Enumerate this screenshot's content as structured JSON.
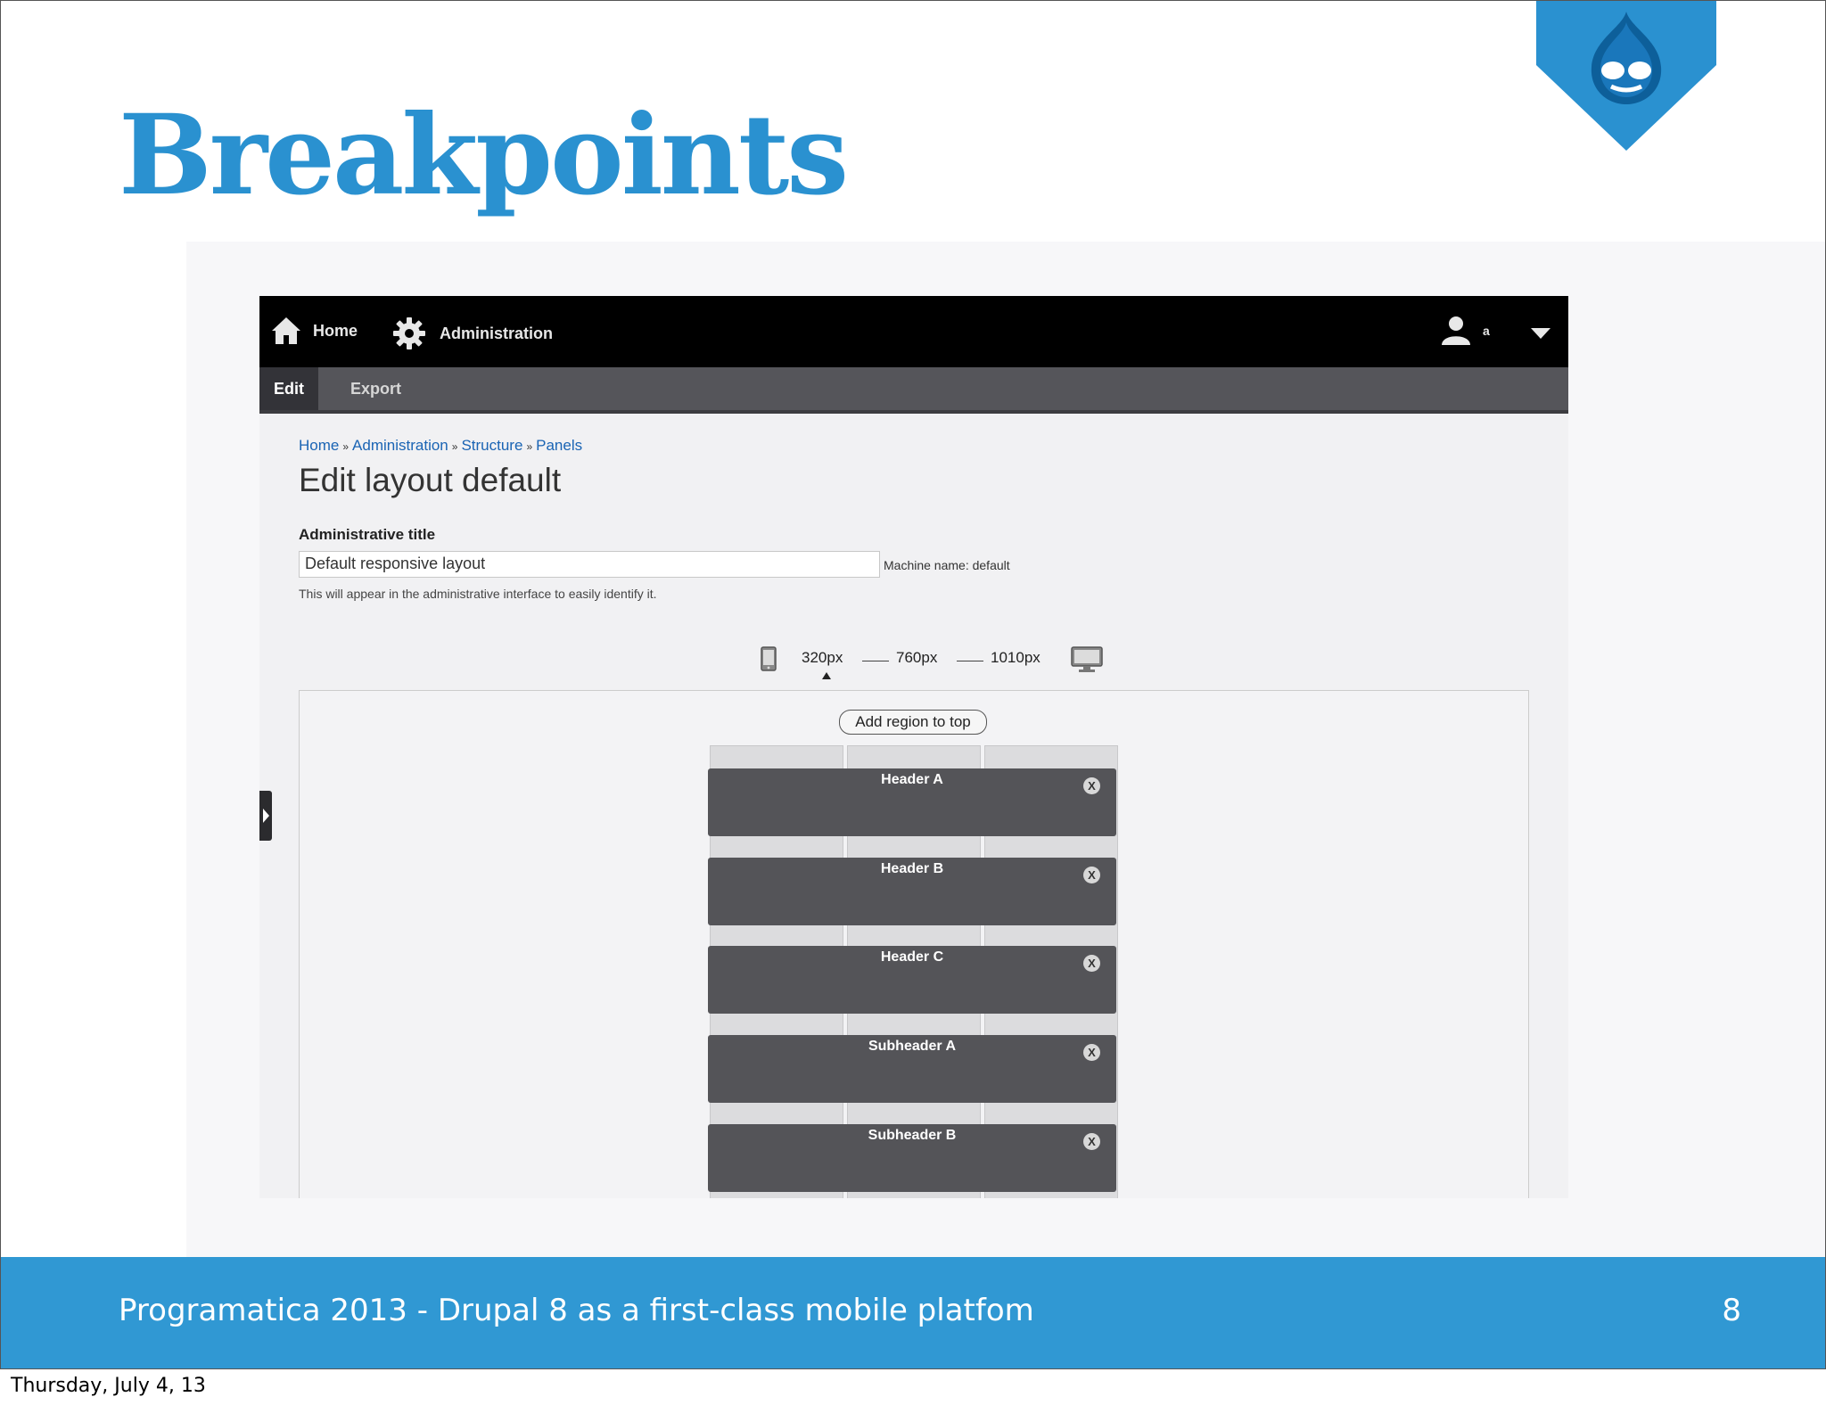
{
  "slide": {
    "title": "Breakpoints",
    "footer_text": "Programatica 2013 - Drupal 8 as a first-class mobile platfom",
    "page_number": "8",
    "date": "Thursday, July 4, 13",
    "accent_color": "#3098d3"
  },
  "screenshot": {
    "toolbar": {
      "home_label": "Home",
      "home_icon": "home-icon",
      "admin_label": "Administration",
      "admin_icon": "gear-icon",
      "user_label": "a",
      "user_icon": "user-icon",
      "menu_icon": "caret-down-icon"
    },
    "tabs": [
      {
        "label": "Edit",
        "active": true
      },
      {
        "label": "Export",
        "active": false
      }
    ],
    "breadcrumb": {
      "items": [
        "Home",
        "Administration",
        "Structure",
        "Panels"
      ],
      "separator": "»"
    },
    "page_title": "Edit layout default",
    "form": {
      "title_label": "Administrative title",
      "title_value": "Default responsive layout",
      "machine_name": "Machine name: default",
      "description": "This will appear in the administrative interface to easily identify it."
    },
    "breakpoints": {
      "values": [
        "320px",
        "760px",
        "1010px"
      ],
      "selected": "320px",
      "left_icon": "phone-icon",
      "right_icon": "desktop-icon"
    },
    "add_region_label": "Add region to top",
    "regions": [
      {
        "name": "Header A"
      },
      {
        "name": "Header B"
      },
      {
        "name": "Header C"
      },
      {
        "name": "Subheader A"
      },
      {
        "name": "Subheader B"
      }
    ],
    "remove_label": "X"
  }
}
